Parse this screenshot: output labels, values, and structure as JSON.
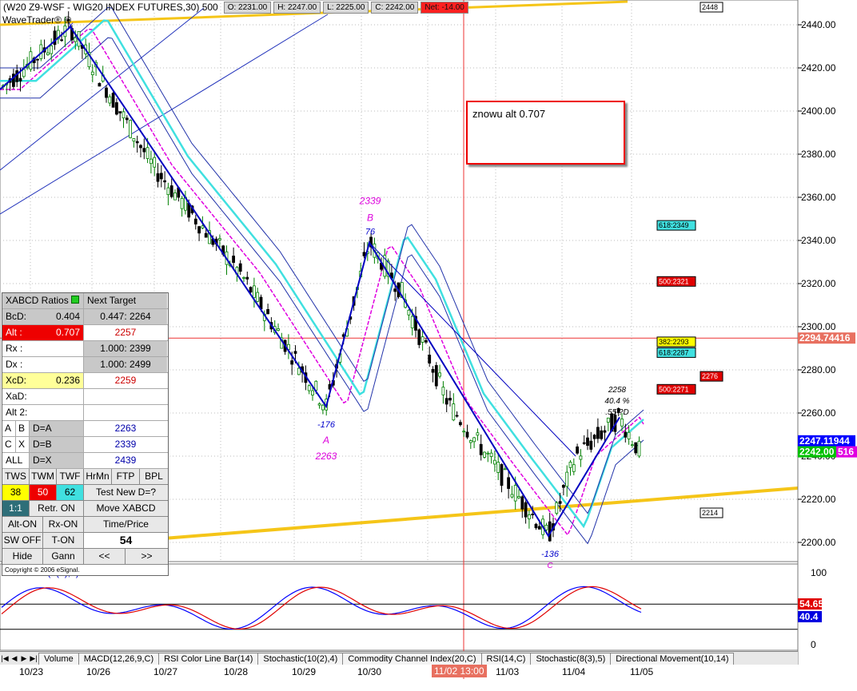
{
  "header": {
    "symbol": "(W20 Z9-WSF - WIG20 INDEX FUTURES,30) 500",
    "open": "O: 2231.00",
    "high": "H: 2247.00",
    "low": "L: 2225.00",
    "close": "C: 2242.00",
    "net": "Net: -14.00",
    "brand": "WaveTrader® ©"
  },
  "chart_data": {
    "type": "candlestick",
    "interval": "30",
    "price_axis": [
      "2440.00",
      "2420.00",
      "2400.00",
      "2380.00",
      "2360.00",
      "2340.00",
      "2320.00",
      "2300.00",
      "2280.00",
      "2260.00",
      "2240.00",
      "2220.00",
      "2200.00"
    ],
    "ylim": [
      2196,
      2451
    ],
    "dates": [
      "10/23",
      "10/26",
      "10/27",
      "10/28",
      "10/29",
      "10/30",
      "11/03",
      "11/04",
      "11/05"
    ],
    "cursor_date": "11/02 13:00",
    "cursor_price": "2294.74416",
    "price_tags": {
      "last": "2242.00",
      "bid": "2247.11944",
      "tag_516": "516"
    },
    "xabcd_points": [
      {
        "label": "X",
        "price": 2439
      },
      {
        "label": "A",
        "value": "-176",
        "price": 2263,
        "price_label": "2263",
        "letter": "A"
      },
      {
        "label": "B",
        "value": "76",
        "price": 2339,
        "price_label": "2339",
        "letter": "B"
      },
      {
        "label": "C",
        "value": "-136",
        "price": 2203,
        "letter": "C"
      },
      {
        "label": "D",
        "price": 2258,
        "lines": [
          "2258",
          "40.4 %",
          ".55 ?D"
        ]
      }
    ],
    "fib_tags": [
      {
        "text": "618:2349",
        "price": 2347,
        "color": "#40e0e0"
      },
      {
        "text": "500:2321",
        "price": 2321,
        "color": "#e00000"
      },
      {
        "text": "382:2293",
        "price": 2293,
        "color": "#ffff00"
      },
      {
        "text": "618:2287",
        "price": 2288,
        "color": "#40e0e0"
      },
      {
        "text": "2276",
        "price": 2277,
        "color": "#e00000"
      },
      {
        "text": "500:2271",
        "price": 2271,
        "color": "#e00000"
      }
    ],
    "level_tags": [
      {
        "text": "2448",
        "price": 2448
      },
      {
        "text": "2214",
        "price": 2214
      }
    ],
    "stochastic": {
      "title": "Stochastic(8(3),5)",
      "axis": [
        "100",
        "0"
      ],
      "k_value": "40.4",
      "d_value": "54.65"
    }
  },
  "note": {
    "text": "znowu alt 0.707"
  },
  "panel": {
    "title": "XABCD Ratios",
    "next_target": "Next Target",
    "bcd_label": "BcD:",
    "bcd_value": "0.404",
    "bcd_target": "0.447: 2264",
    "alt_label": "Alt   :",
    "alt_value": "0.707",
    "alt_target": "2257",
    "rx_label": "Rx   :",
    "rx_target": "1.000: 2399",
    "dx_label": "Dx   :",
    "dx_target": "1.000: 2499",
    "xcd_label": "XcD:",
    "xcd_value": "0.236",
    "xcd_target": "2259",
    "xad_label": "XaD:",
    "alt2_label": "Alt 2:",
    "row_a": "A",
    "row_b": "B",
    "row_da": "D=A",
    "val_da": "2263",
    "row_c": "C",
    "row_x": "X",
    "row_db": "D=B",
    "val_db": "2339",
    "row_all": "ALL",
    "row_dx": "D=X",
    "val_dx": "2439",
    "tws": "TWS",
    "twm": "TWM",
    "twf": "TWF",
    "hrmn": "HrMn",
    "ftp": "FTP",
    "bpl": "BPL",
    "tws_val": "38",
    "twm_val": "50",
    "twf_val": "62",
    "test_new": "Test New D=?",
    "ratio": "1:1",
    "retr_on": "Retr. ON",
    "move_xabcd": "Move XABCD",
    "alt_on": "Alt-ON",
    "rx_on": "Rx-ON",
    "time_price": "Time/Price",
    "sw_off": "SW OFF",
    "t_on": "T-ON",
    "count": "54",
    "hide": "Hide",
    "gann": "Gann",
    "prev": "<<",
    "next": ">>",
    "copyright": "Copyright © 2006 eSignal."
  },
  "tabs": [
    "Volume",
    "MACD(12,26,9,C)",
    "RSI Color Line Bar(14)",
    "Stochastic(10(2),4)",
    "Commodity Channel Index(20,C)",
    "RSI(14,C)",
    "Stochastic(8(3),5)",
    "Directional Movement(10,14)"
  ],
  "colors": {
    "candle_up": "#008000",
    "candle_down": "#000000",
    "wave_line": "#0000c0",
    "ma_cyan": "#40e0e0",
    "ma_magenta": "#e000e0",
    "trendline": "#f5c518",
    "stoch_k": "#0000ff",
    "stoch_d": "#e00000"
  }
}
